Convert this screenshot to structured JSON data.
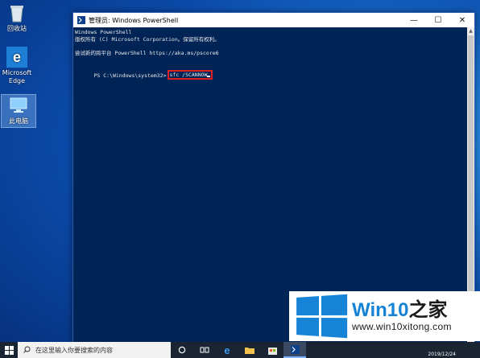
{
  "desktop": {
    "icons": [
      {
        "label": "回收站",
        "icon": "recycle-bin-icon"
      },
      {
        "label": "Microsoft Edge",
        "icon": "edge-icon"
      },
      {
        "label": "此电脑",
        "icon": "this-pc-icon"
      }
    ]
  },
  "window": {
    "title": "管理员: Windows PowerShell",
    "controls": {
      "minimize": "—",
      "maximize": "☐",
      "close": "✕"
    }
  },
  "console": {
    "lines": [
      "Windows PowerShell",
      "版权所有 (C) Microsoft Corporation。保留所有权利。",
      "",
      "尝试新的跨平台 PowerShell https://aka.ms/pscore6",
      ""
    ],
    "prompt": "PS C:\\Windows\\system32>",
    "command": "sfc /SCANNOW"
  },
  "taskbar": {
    "search_placeholder": "在这里输入你要搜索的内容",
    "date": "2019/12/24"
  },
  "watermark": {
    "brand_main": "Win10",
    "brand_suffix": "之家",
    "url": "www.win10xitong.com"
  },
  "colors": {
    "console_bg": "#012456",
    "highlight": "#e02020",
    "brand_blue": "#1683d6"
  }
}
